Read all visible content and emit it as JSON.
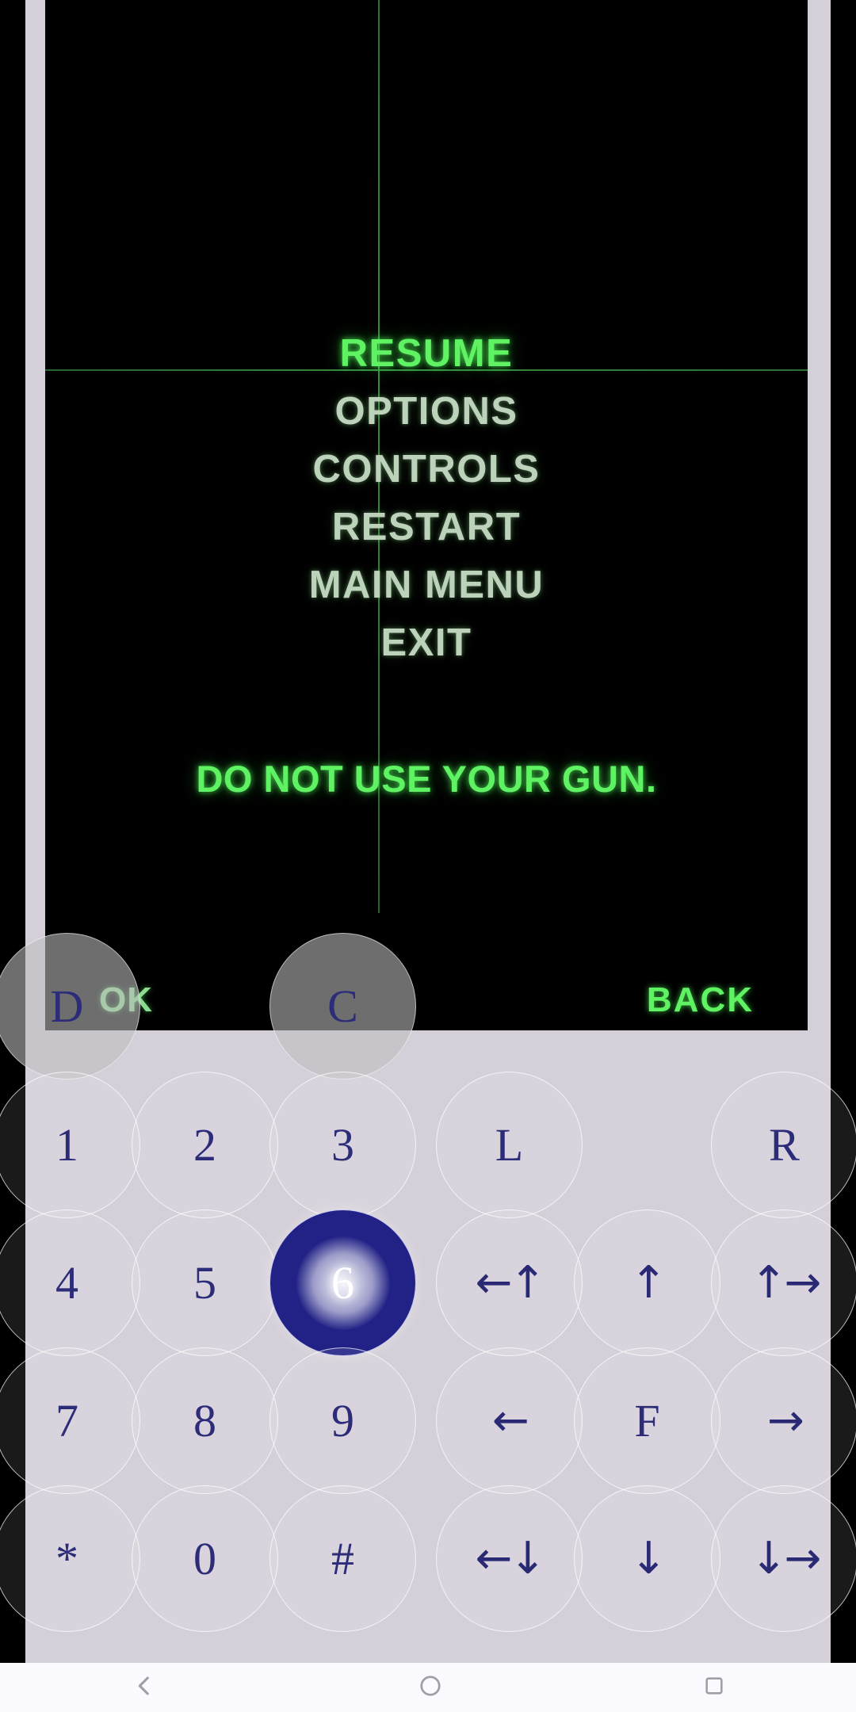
{
  "app": {
    "kind": "j2me-mobile-game-emulator",
    "background_color": "#d4cfd8",
    "screen_background": "#000000"
  },
  "game_screen": {
    "accent_selected_color": "#5ff263",
    "accent_idle_color": "#bcd2bb",
    "crosshair_color": "#3e9a46",
    "pause_menu": {
      "items": [
        {
          "label": "RESUME",
          "selected": true
        },
        {
          "label": "OPTIONS",
          "selected": false
        },
        {
          "label": "CONTROLS",
          "selected": false
        },
        {
          "label": "RESTART",
          "selected": false
        },
        {
          "label": "MAIN MENU",
          "selected": false
        },
        {
          "label": "EXIT",
          "selected": false
        }
      ]
    },
    "hint_text": "DO NOT USE YOUR GUN.",
    "softkeys": {
      "left_label": "OK",
      "right_label": "BACK"
    }
  },
  "keypad": {
    "label_color": "#2c2c78",
    "pressed_key": "6",
    "rows": [
      [
        {
          "glyph": "D",
          "name": "key-d",
          "kind": "letter"
        },
        {
          "glyph": "C",
          "name": "key-c",
          "kind": "letter"
        }
      ],
      [
        {
          "glyph": "1",
          "name": "key-1",
          "kind": "digit"
        },
        {
          "glyph": "2",
          "name": "key-2",
          "kind": "digit"
        },
        {
          "glyph": "3",
          "name": "key-3",
          "kind": "digit"
        },
        {
          "glyph": "L",
          "name": "key-l",
          "kind": "letter"
        },
        {
          "glyph": "R",
          "name": "key-r",
          "kind": "letter"
        }
      ],
      [
        {
          "glyph": "4",
          "name": "key-4",
          "kind": "digit"
        },
        {
          "glyph": "5",
          "name": "key-5",
          "kind": "digit"
        },
        {
          "glyph": "6",
          "name": "key-6",
          "kind": "digit",
          "pressed": true
        },
        {
          "glyph": "←↑",
          "name": "key-up-left",
          "kind": "arrow"
        },
        {
          "glyph": "↑",
          "name": "key-up",
          "kind": "arrow"
        },
        {
          "glyph": "↑→",
          "name": "key-up-right",
          "kind": "arrow"
        }
      ],
      [
        {
          "glyph": "7",
          "name": "key-7",
          "kind": "digit"
        },
        {
          "glyph": "8",
          "name": "key-8",
          "kind": "digit"
        },
        {
          "glyph": "9",
          "name": "key-9",
          "kind": "digit"
        },
        {
          "glyph": "←",
          "name": "key-left",
          "kind": "arrow"
        },
        {
          "glyph": "F",
          "name": "key-f",
          "kind": "letter"
        },
        {
          "glyph": "→",
          "name": "key-right",
          "kind": "arrow"
        }
      ],
      [
        {
          "glyph": "*",
          "name": "key-star",
          "kind": "symbol"
        },
        {
          "glyph": "0",
          "name": "key-0",
          "kind": "digit"
        },
        {
          "glyph": "#",
          "name": "key-hash",
          "kind": "symbol"
        },
        {
          "glyph": "←↓",
          "name": "key-down-left",
          "kind": "arrow"
        },
        {
          "glyph": "↓",
          "name": "key-down",
          "kind": "arrow"
        },
        {
          "glyph": "↓→",
          "name": "key-down-right",
          "kind": "arrow"
        }
      ]
    ]
  },
  "navbar": {
    "items": [
      {
        "name": "nav-back-icon"
      },
      {
        "name": "nav-home-icon"
      },
      {
        "name": "nav-recents-icon"
      }
    ]
  }
}
